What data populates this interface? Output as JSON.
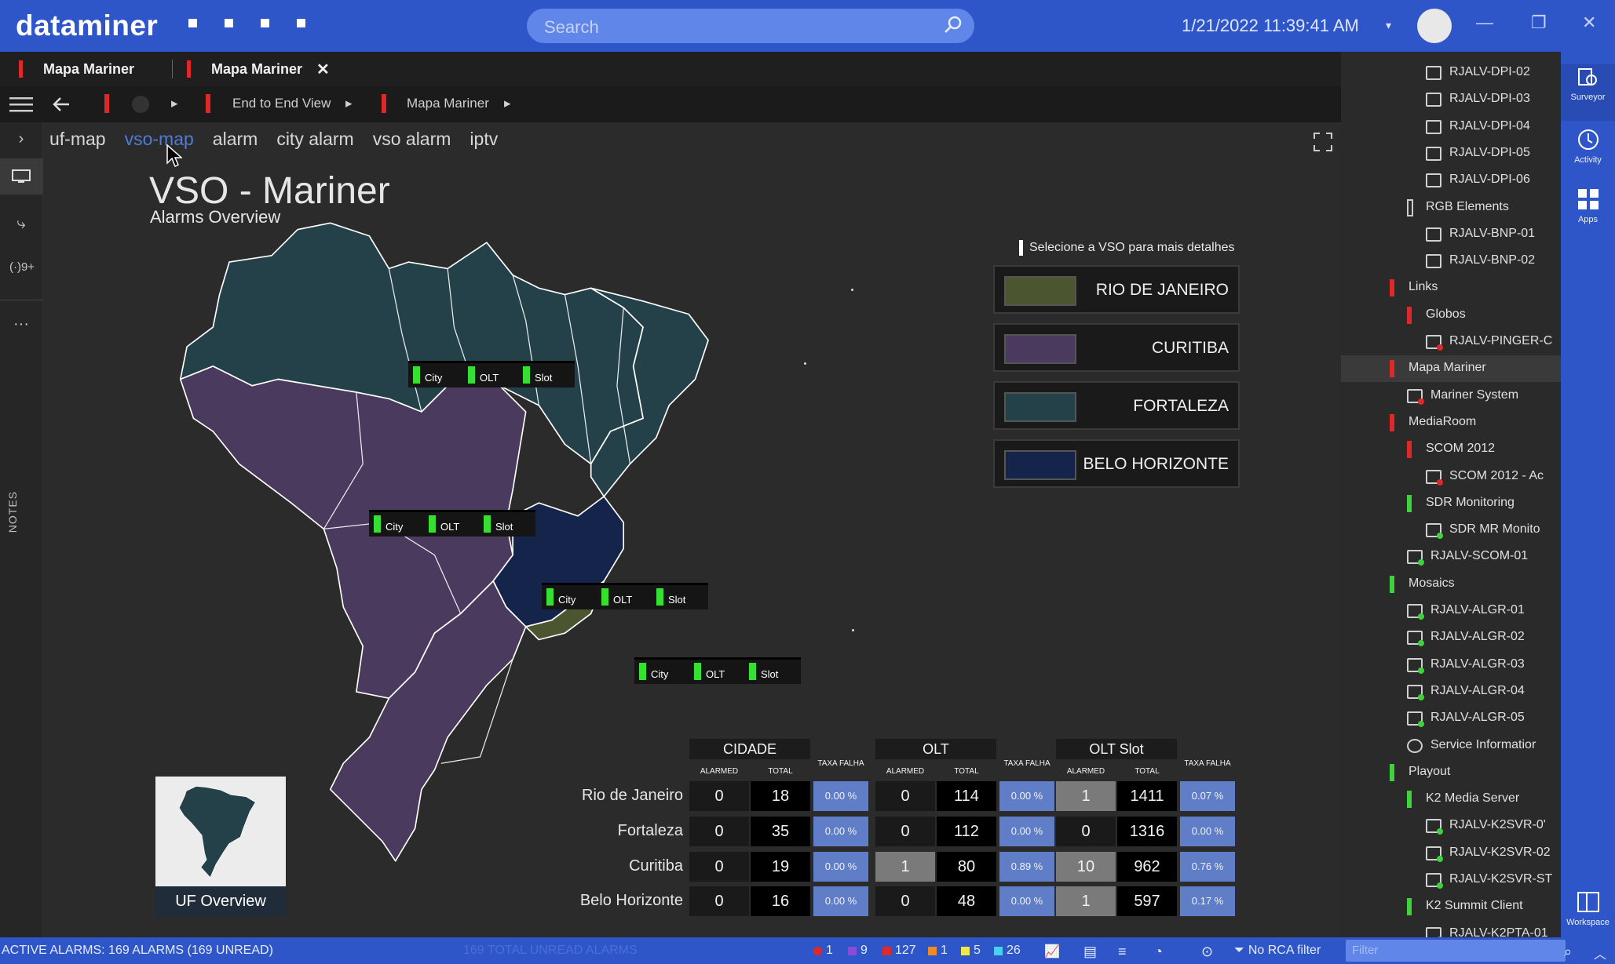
{
  "app": {
    "logo": "dataminer",
    "search_placeholder": "Search",
    "datetime": "1/21/2022 11:39:41 AM"
  },
  "tabs": [
    {
      "label": "Mapa Mariner"
    },
    {
      "label": "Mapa Mariner"
    }
  ],
  "nav": {
    "end_to_end": "End to End View",
    "mapa": "Mapa Mariner"
  },
  "rail": {
    "notes": "NOTES",
    "signal": "(·)9+"
  },
  "subtabs": [
    "uf-map",
    "vso-map",
    "alarm",
    "city alarm",
    "vso alarm",
    "iptv"
  ],
  "page": {
    "title": "VSO - Mariner",
    "subtitle": "Alarms Overview"
  },
  "chips": {
    "city": "City",
    "olt": "OLT",
    "slot": "Slot"
  },
  "legend": {
    "header": "Selecione a VSO para mais detalhes",
    "items": [
      {
        "label": "RIO DE JANEIRO",
        "color": "#4b5530"
      },
      {
        "label": "CURITIBA",
        "color": "#4a3a5e"
      },
      {
        "label": "FORTALEZA",
        "color": "#24414a"
      },
      {
        "label": "BELO HORIZONTE",
        "color": "#14244a"
      }
    ]
  },
  "uf_overview": "UF Overview",
  "table": {
    "groups": [
      "CIDADE",
      "OLT",
      "OLT Slot"
    ],
    "sub": {
      "alarmed": "ALARMED",
      "total": "TOTAL",
      "taxa": "TAXA FALHA"
    },
    "rows": [
      {
        "name": "Rio de Janeiro",
        "c": [
          "0",
          "18",
          "0.00 %"
        ],
        "o": [
          "0",
          "114",
          "0.00 %"
        ],
        "s": [
          "1",
          "1411",
          "0.07 %"
        ]
      },
      {
        "name": "Fortaleza",
        "c": [
          "0",
          "35",
          "0.00 %"
        ],
        "o": [
          "0",
          "112",
          "0.00 %"
        ],
        "s": [
          "0",
          "1316",
          "0.00 %"
        ]
      },
      {
        "name": "Curitiba",
        "c": [
          "0",
          "19",
          "0.00 %"
        ],
        "o": [
          "1",
          "80",
          "0.89 %"
        ],
        "s": [
          "10",
          "962",
          "0.76 %"
        ]
      },
      {
        "name": "Belo Horizonte",
        "c": [
          "0",
          "16",
          "0.00 %"
        ],
        "o": [
          "0",
          "48",
          "0.00 %"
        ],
        "s": [
          "1",
          "597",
          "0.17 %"
        ]
      }
    ]
  },
  "tree": [
    {
      "label": "RJALV-DPI-02",
      "indent": 2,
      "type": "ic"
    },
    {
      "label": "RJALV-DPI-03",
      "indent": 2,
      "type": "ic"
    },
    {
      "label": "RJALV-DPI-04",
      "indent": 2,
      "type": "ic"
    },
    {
      "label": "RJALV-DPI-05",
      "indent": 2,
      "type": "ic"
    },
    {
      "label": "RJALV-DPI-06",
      "indent": 2,
      "type": "ic"
    },
    {
      "label": "RGB Elements",
      "indent": 1,
      "type": "mk",
      "color": "#3a3a3a"
    },
    {
      "label": "RJALV-BNP-01",
      "indent": 2,
      "type": "ic"
    },
    {
      "label": "RJALV-BNP-02",
      "indent": 2,
      "type": "ic"
    },
    {
      "label": "Links",
      "indent": 0,
      "type": "mk",
      "color": "#e02828"
    },
    {
      "label": "Globos",
      "indent": 1,
      "type": "mk",
      "color": "#e02828"
    },
    {
      "label": "RJALV-PINGER-C",
      "indent": 2,
      "type": "ic",
      "dot": "#e02828"
    },
    {
      "label": "Mapa Mariner",
      "indent": 0,
      "type": "mk",
      "color": "#e02828",
      "sel": true
    },
    {
      "label": "Mariner System",
      "indent": 1,
      "type": "ic",
      "dot": "#e02828"
    },
    {
      "label": "MediaRoom",
      "indent": 0,
      "type": "mk",
      "color": "#e02828"
    },
    {
      "label": "SCOM 2012",
      "indent": 1,
      "type": "mk",
      "color": "#e02828"
    },
    {
      "label": "SCOM 2012 - Ac",
      "indent": 2,
      "type": "ic",
      "dot": "#e02828"
    },
    {
      "label": "SDR Monitoring",
      "indent": 1,
      "type": "mk",
      "color": "#3fd23a"
    },
    {
      "label": "SDR MR Monito",
      "indent": 2,
      "type": "ic",
      "dot": "#3fd23a"
    },
    {
      "label": "RJALV-SCOM-01",
      "indent": 1,
      "type": "ic",
      "dot": "#3fd23a"
    },
    {
      "label": "Mosaics",
      "indent": 0,
      "type": "mk",
      "color": "#3fd23a"
    },
    {
      "label": "RJALV-ALGR-01",
      "indent": 1,
      "type": "ic",
      "dot": "#3fd23a"
    },
    {
      "label": "RJALV-ALGR-02",
      "indent": 1,
      "type": "ic",
      "dot": "#3fd23a"
    },
    {
      "label": "RJALV-ALGR-03",
      "indent": 1,
      "type": "ic",
      "dot": "#3fd23a"
    },
    {
      "label": "RJALV-ALGR-04",
      "indent": 1,
      "type": "ic",
      "dot": "#3fd23a"
    },
    {
      "label": "RJALV-ALGR-05",
      "indent": 1,
      "type": "ic",
      "dot": "#3fd23a"
    },
    {
      "label": "Service Informatior",
      "indent": 1,
      "type": "svc"
    },
    {
      "label": "Playout",
      "indent": 0,
      "type": "mk",
      "color": "#3fd23a"
    },
    {
      "label": "K2 Media Server",
      "indent": 1,
      "type": "mk",
      "color": "#3fd23a"
    },
    {
      "label": "RJALV-K2SVR-0'",
      "indent": 2,
      "type": "ic",
      "dot": "#3fd23a"
    },
    {
      "label": "RJALV-K2SVR-02",
      "indent": 2,
      "type": "ic",
      "dot": "#3fd23a"
    },
    {
      "label": "RJALV-K2SVR-ST",
      "indent": 2,
      "type": "ic",
      "dot": "#3fd23a"
    },
    {
      "label": "K2 Summit Client",
      "indent": 1,
      "type": "mk",
      "color": "#3fd23a"
    },
    {
      "label": "RJALV-K2PTA-01",
      "indent": 2,
      "type": "ic",
      "dot": "#3fd23a"
    }
  ],
  "farright": [
    "Surveyor",
    "Activity",
    "Apps",
    "Workspace"
  ],
  "status": {
    "alarms": "ACTIVE ALARMS: 169 ALARMS (169 UNREAD)",
    "faint": "169 TOTAL UNREAD ALARMS",
    "counts": [
      {
        "v": "1",
        "color": "#e02828"
      },
      {
        "v": "9",
        "color": "#8a4bd6"
      },
      {
        "v": "127",
        "color": "#e02828"
      },
      {
        "v": "1",
        "color": "#f08a24"
      },
      {
        "v": "5",
        "color": "#f2e64a"
      },
      {
        "v": "26",
        "color": "#4ad0f0"
      }
    ],
    "rca": "No RCA filter",
    "filter_placeholder": "Filter"
  }
}
